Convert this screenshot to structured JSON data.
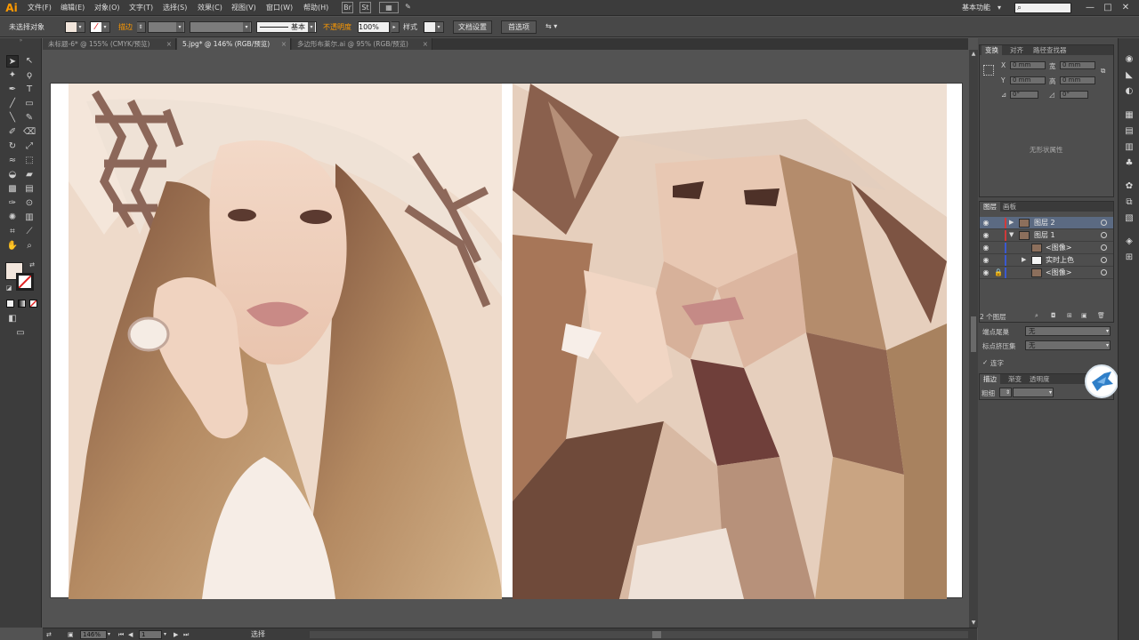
{
  "app": {
    "logo": "Ai",
    "menu": [
      "文件(F)",
      "编辑(E)",
      "对象(O)",
      "文字(T)",
      "选择(S)",
      "效果(C)",
      "视图(V)",
      "窗口(W)",
      "帮助(H)"
    ],
    "workspace": "基本功能",
    "search_placeholder": "",
    "win_min": "—",
    "win_max": "□",
    "win_close": "✕"
  },
  "control": {
    "selection_state": "未选择对象",
    "stroke_label": "描边",
    "stroke_style": "基本",
    "opacity_label": "不透明度",
    "opacity_value": "100%",
    "style_label": "样式",
    "doc_setup": "文档设置",
    "preferences": "首选项"
  },
  "tabs": [
    {
      "label": "未标题-6* @ 155% (CMYK/预览)",
      "active": false
    },
    {
      "label": "5.jpg* @ 146% (RGB/预览)",
      "active": true
    },
    {
      "label": "多边形布莱尔.ai @ 95% (RGB/预览)",
      "active": false
    }
  ],
  "transform_panel": {
    "tabs": [
      "变换",
      "对齐",
      "路径查找器"
    ],
    "x_label": "X",
    "x_value": "0 mm",
    "w_label": "宽",
    "w_value": "0 mm",
    "y_label": "Y",
    "y_value": "0 mm",
    "h_label": "高",
    "h_value": "0 mm",
    "angle1": "0°",
    "angle2": "0°",
    "no_shape": "无形状属性"
  },
  "layers_panel": {
    "tabs": [
      "图层",
      "画板"
    ],
    "rows": [
      {
        "name": "图层 2",
        "expanded": false,
        "indent": 0,
        "color": "#d03a3a",
        "highlight": true
      },
      {
        "name": "图层 1",
        "expanded": true,
        "indent": 0,
        "color": "#d03a3a",
        "highlight": false
      },
      {
        "name": "<图像>",
        "expanded": null,
        "indent": 1,
        "color": "#3a59d0",
        "highlight": false
      },
      {
        "name": "实时上色",
        "expanded": false,
        "indent": 1,
        "color": "#3a59d0",
        "highlight": false
      },
      {
        "name": "<图像>",
        "expanded": null,
        "indent": 1,
        "color": "#3a59d0",
        "highlight": false
      }
    ],
    "count": "2 个图层"
  },
  "properties": {
    "cap_label": "端点尾巢",
    "cap_value": "无",
    "dash_label": "标点挤压集",
    "dash_value": "无",
    "connect_label": "连字"
  },
  "stroke_panel": {
    "tabs": [
      "描边",
      "渐变",
      "透明度"
    ],
    "weight_label": "粗细"
  },
  "status": {
    "zoom": "146%",
    "artboard": "1",
    "tool": "选择"
  },
  "colors": {
    "accent_orange": "#ff9a00",
    "layer_red": "#d03a3a",
    "layer_blue": "#3a59d0",
    "highlight_row": "#5b6a82"
  }
}
